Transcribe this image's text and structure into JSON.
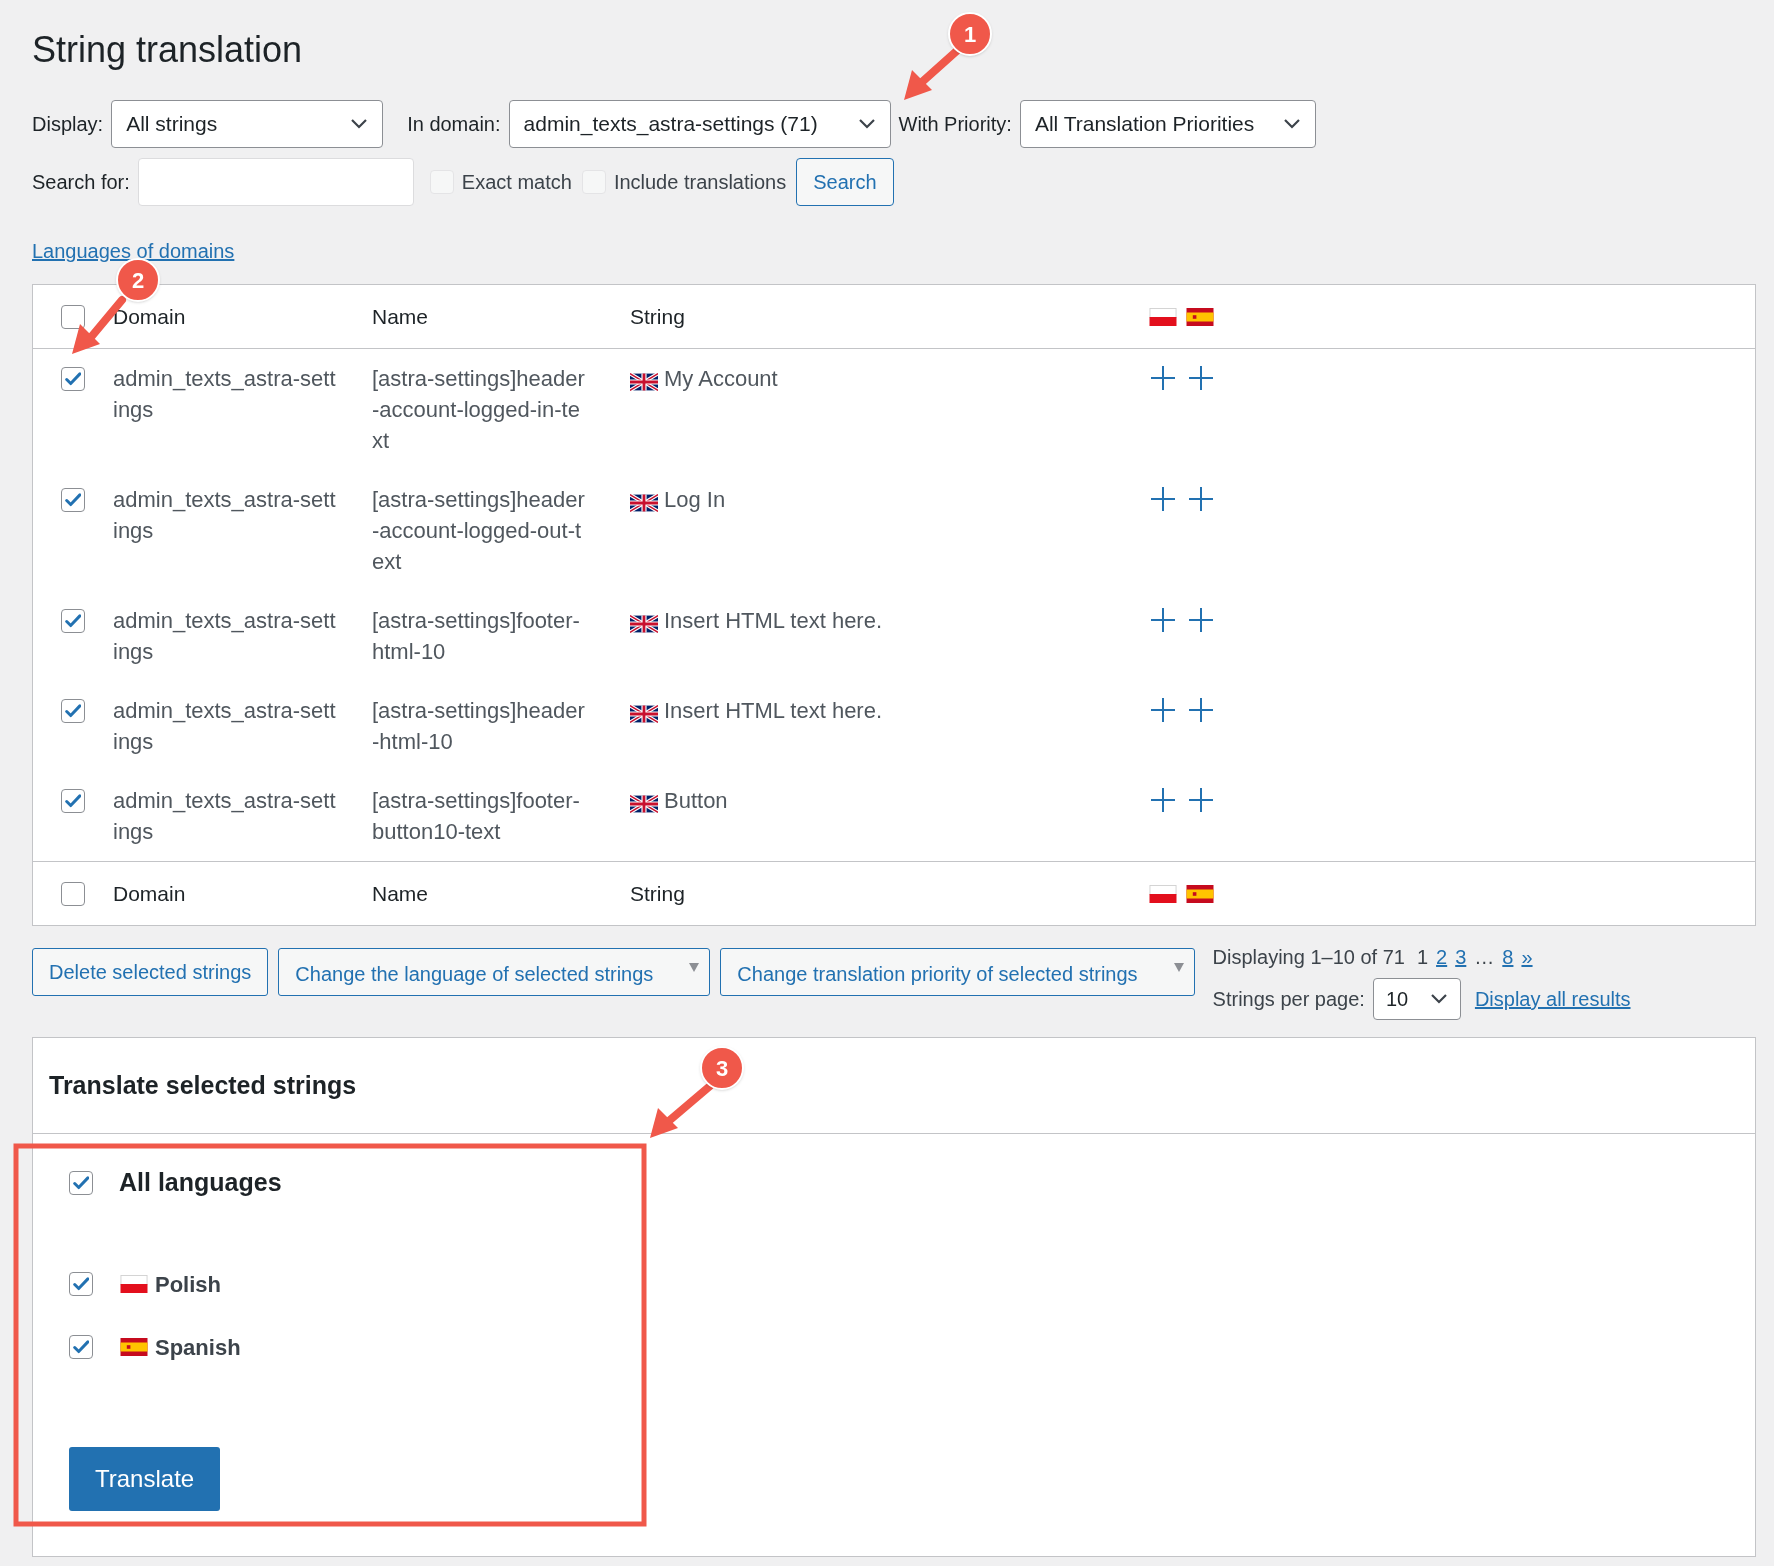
{
  "title": "String translation",
  "filters": [
    {
      "label": "Display:",
      "value": "All strings"
    },
    {
      "label": "In domain:",
      "value": "admin_texts_astra-settings (71)"
    },
    {
      "label": "With Priority:",
      "value": "All Translation Priorities"
    }
  ],
  "search": {
    "label": "Search for:",
    "options": [
      {
        "label": "Exact match",
        "checked": false
      },
      {
        "label": "Include translations",
        "checked": false
      }
    ],
    "button": "Search"
  },
  "domains_link": "Languages of domains",
  "table": {
    "columns": [
      "Domain",
      "Name",
      "String"
    ],
    "all_checked": false,
    "rows": [
      {
        "checked": true,
        "domain": "admin_texts_astra-settings",
        "name": "[astra-settings]header-account-logged-in-text",
        "string": "My Account"
      },
      {
        "checked": true,
        "domain": "admin_texts_astra-settings",
        "name": "[astra-settings]header-account-logged-out-text",
        "string": "Log In"
      },
      {
        "checked": true,
        "domain": "admin_texts_astra-settings",
        "name": "[astra-settings]footer-html-10",
        "string": "Insert HTML text here."
      },
      {
        "checked": true,
        "domain": "admin_texts_astra-settings",
        "name": "[astra-settings]header-html-10",
        "string": "Insert HTML text here."
      },
      {
        "checked": true,
        "domain": "admin_texts_astra-settings",
        "name": "[astra-settings]footer-button10-text",
        "string": "Button"
      }
    ],
    "footer_columns": [
      "Domain",
      "Name",
      "String"
    ],
    "footer_checked": false
  },
  "bulk_actions": [
    {
      "kind": "button",
      "label": "Delete selected strings"
    },
    {
      "kind": "dropdown",
      "label": "Change the language of selected strings"
    },
    {
      "kind": "dropdown",
      "label": "Change translation priority of selected strings"
    }
  ],
  "pagination": {
    "summary": "Displaying 1–10 of 71",
    "pages": [
      {
        "kind": "current",
        "label": "1"
      },
      {
        "kind": "link",
        "label": "2"
      },
      {
        "kind": "link",
        "label": "3"
      },
      {
        "kind": "ellipsis",
        "label": "…"
      },
      {
        "kind": "link",
        "label": "8"
      },
      {
        "kind": "link",
        "label": "»"
      }
    ],
    "per_page_label": "Strings per page:",
    "per_page": "10",
    "display_all": "Display all results"
  },
  "translate_panel": {
    "title": "Translate selected strings",
    "all": {
      "label": "All languages",
      "checked": true
    },
    "languages": [
      {
        "kind": "pl",
        "label": "Polish",
        "checked": true
      },
      {
        "kind": "es",
        "label": "Spanish",
        "checked": true
      }
    ],
    "button": "Translate"
  },
  "callouts": [
    "1",
    "2",
    "3"
  ]
}
